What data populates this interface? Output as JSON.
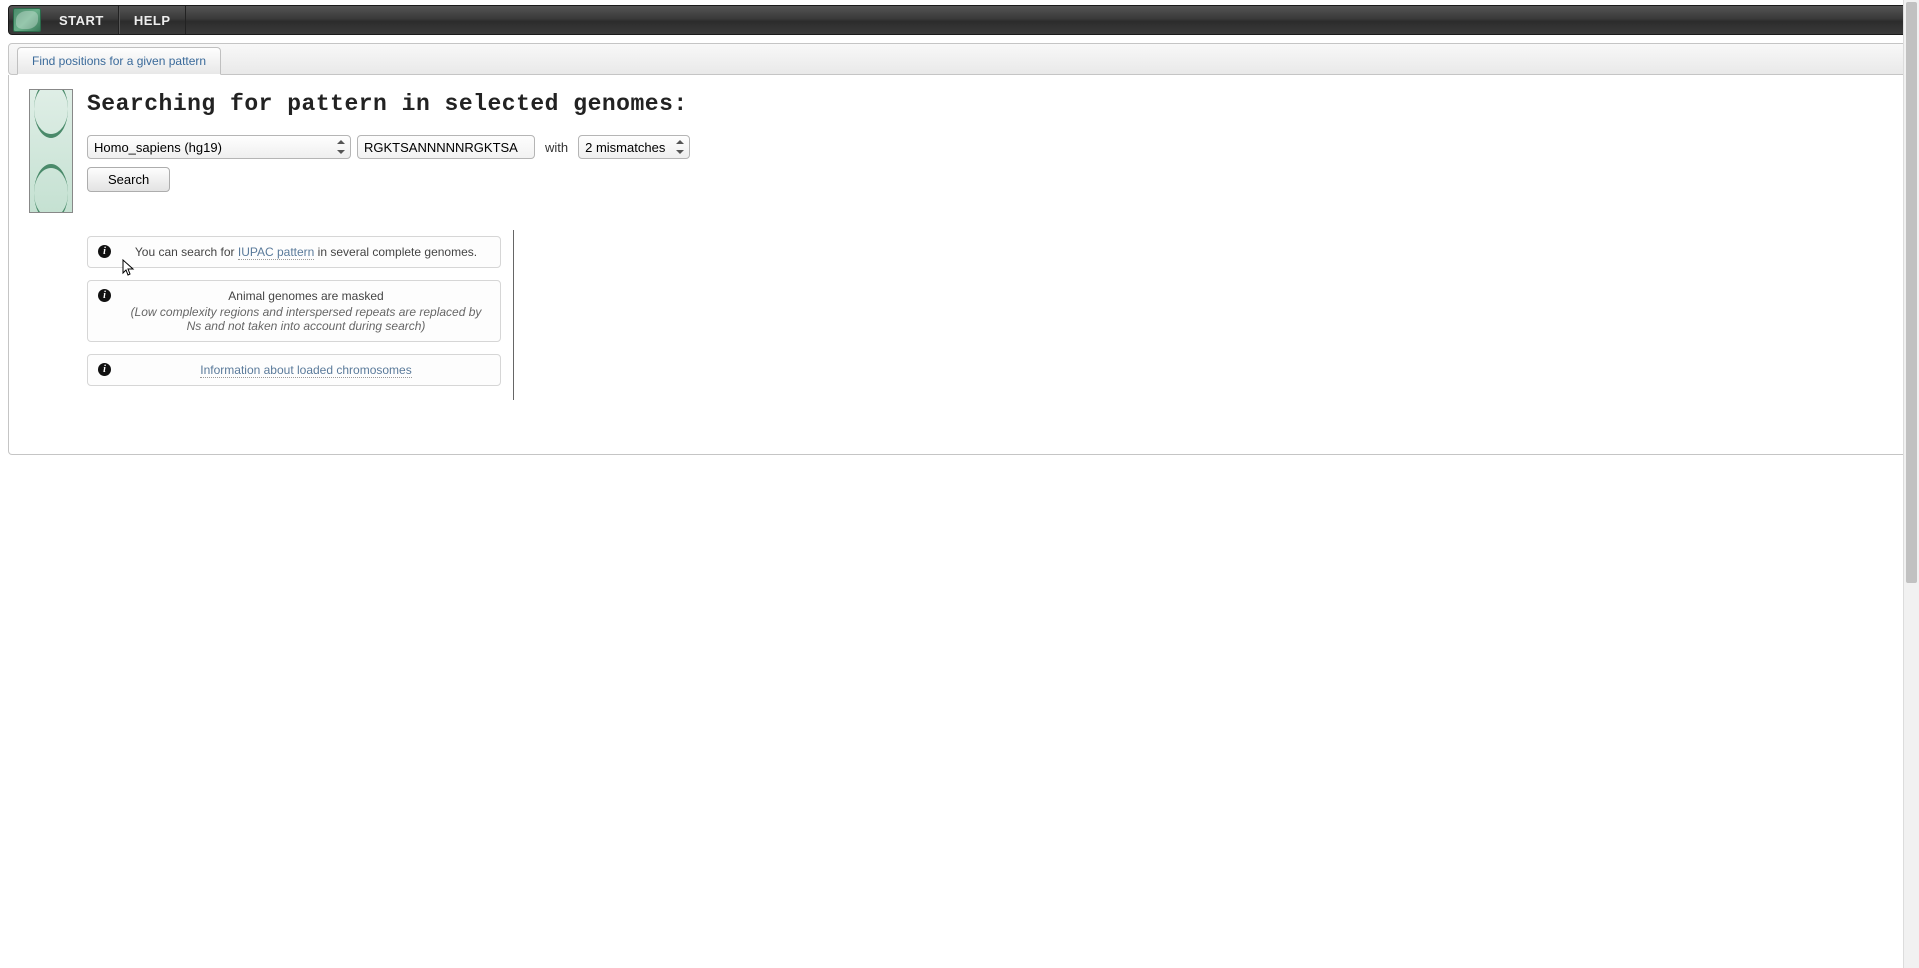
{
  "menu": {
    "start": "START",
    "help": "HELP"
  },
  "tab": {
    "label": "Find positions for a given pattern"
  },
  "heading": "Searching for pattern in selected genomes:",
  "form": {
    "genome_selected": "Homo_sapiens (hg19)",
    "pattern_value": "RGKTSANNNNNRGKTSA",
    "with_label": "with",
    "mismatch_selected": "2 mismatches",
    "search_label": "Search"
  },
  "info": {
    "box1_pre": "You can search for ",
    "box1_link": "IUPAC pattern",
    "box1_post": " in several complete genomes.",
    "box2_title": "Animal genomes are masked",
    "box2_sub": "(Low complexity regions and interspersed repeats are replaced by Ns and not taken into account during search)",
    "box3_link": "Information about loaded chromosomes"
  }
}
